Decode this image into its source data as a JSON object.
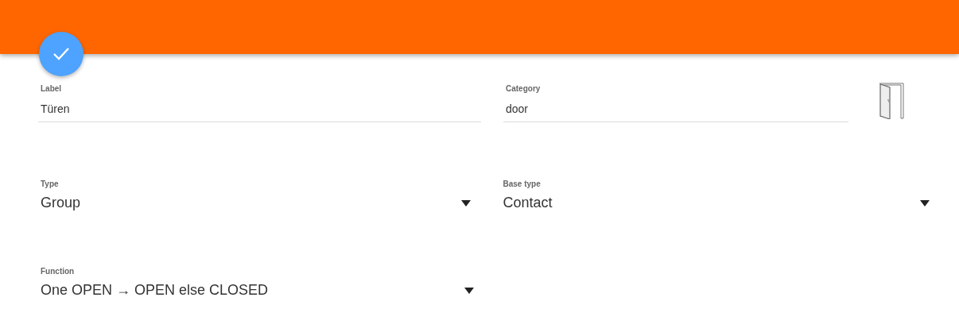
{
  "rows": [
    {
      "fields": [
        {
          "kind": "text",
          "label": "Label",
          "value": "Türen"
        },
        {
          "kind": "text",
          "label": "Category",
          "value": "door"
        }
      ],
      "category_icon": true
    },
    {
      "fields": [
        {
          "kind": "select",
          "label": "Type",
          "value": "Group"
        },
        {
          "kind": "select",
          "label": "Base type",
          "value": "Contact"
        }
      ]
    },
    {
      "fields": [
        {
          "kind": "select",
          "label": "Function",
          "value": "One OPEN → OPEN else CLOSED"
        }
      ]
    }
  ]
}
